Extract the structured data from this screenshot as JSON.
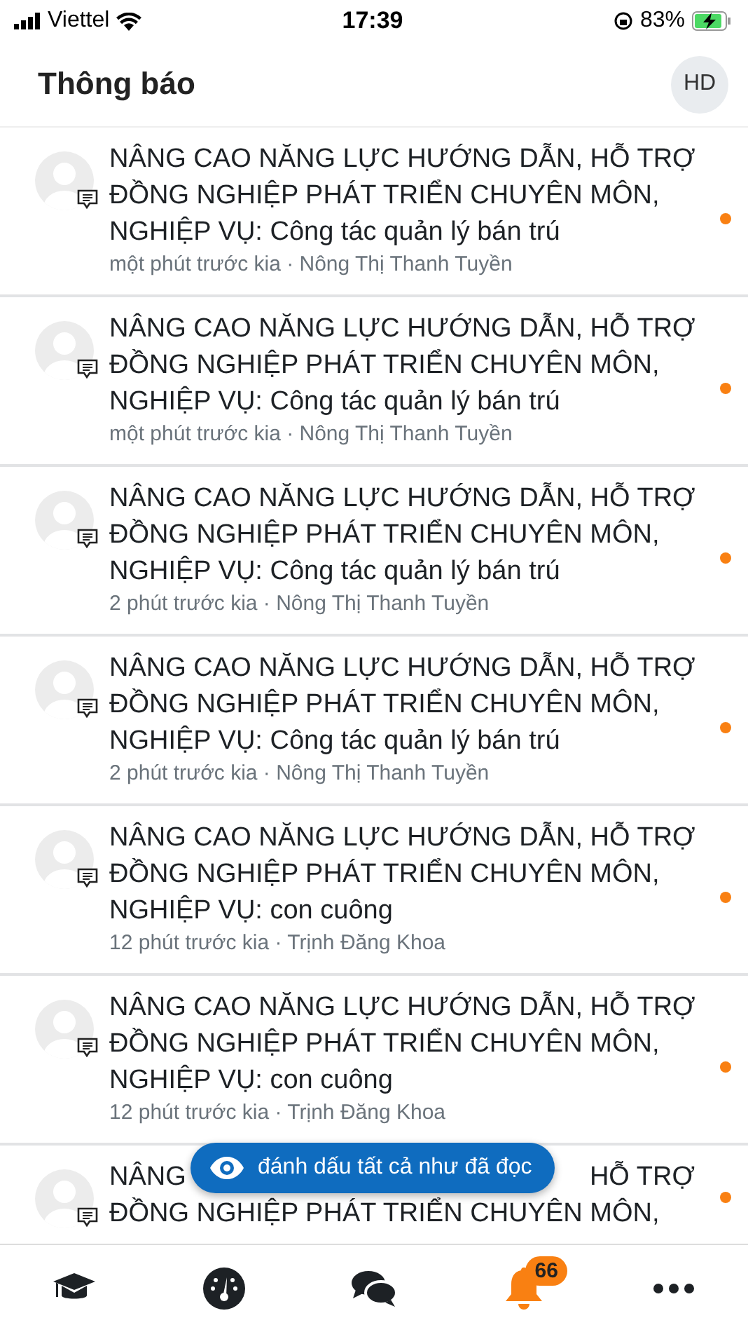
{
  "status_bar": {
    "carrier": "Viettel",
    "time": "17:39",
    "battery": "83%"
  },
  "header": {
    "title": "Thông báo",
    "avatar_initials": "HD"
  },
  "notifications": [
    {
      "title": "NÂNG CAO NĂNG LỰC HƯỚNG DẪN, HỖ TRỢ ĐỒNG NGHIỆP PHÁT TRIỂN CHUYÊN MÔN, NGHIỆP VỤ: Công tác quản lý bán trú",
      "meta": "một phút trước kia · Nông Thị Thanh Tuyền",
      "unread": true
    },
    {
      "title": "NÂNG CAO NĂNG LỰC HƯỚNG DẪN, HỖ TRỢ ĐỒNG NGHIỆP PHÁT TRIỂN CHUYÊN MÔN, NGHIỆP VỤ: Công tác quản lý bán trú",
      "meta": "một phút trước kia · Nông Thị Thanh Tuyền",
      "unread": true
    },
    {
      "title": "NÂNG CAO NĂNG LỰC HƯỚNG DẪN, HỖ TRỢ ĐỒNG NGHIỆP PHÁT TRIỂN CHUYÊN MÔN, NGHIỆP VỤ: Công tác quản lý bán trú",
      "meta": "2 phút trước kia · Nông Thị Thanh Tuyền",
      "unread": true
    },
    {
      "title": "NÂNG CAO NĂNG LỰC HƯỚNG DẪN, HỖ TRỢ ĐỒNG NGHIỆP PHÁT TRIỂN CHUYÊN MÔN, NGHIỆP VỤ: Công tác quản lý bán trú",
      "meta": "2 phút trước kia · Nông Thị Thanh Tuyền",
      "unread": true
    },
    {
      "title": "NÂNG CAO NĂNG LỰC HƯỚNG DẪN, HỖ TRỢ ĐỒNG NGHIỆP PHÁT TRIỂN CHUYÊN MÔN, NGHIỆP VỤ: con cuông",
      "meta": "12 phút trước kia · Trịnh Đăng Khoa",
      "unread": true
    },
    {
      "title": "NÂNG CAO NĂNG LỰC HƯỚNG DẪN, HỖ TRỢ ĐỒNG NGHIỆP PHÁT TRIỂN CHUYÊN MÔN, NGHIỆP VỤ: con cuông",
      "meta": "12 phút trước kia · Trịnh Đăng Khoa",
      "unread": true
    },
    {
      "kind": "partial",
      "title_start": "NÂNG",
      "title_end": "HỖ TRỢ",
      "title_line2": "ĐỒNG NGHIỆP PHÁT TRIỂN CHUYÊN MÔN,",
      "unread": true
    }
  ],
  "mark_all_button": {
    "label": "đánh dấu tất cả như đã đọc"
  },
  "bottom_nav": [
    {
      "kind": "courses",
      "selected": false
    },
    {
      "kind": "dashboard",
      "selected": false
    },
    {
      "kind": "messages",
      "selected": false
    },
    {
      "kind": "notifications",
      "selected": true,
      "badge": "66"
    },
    {
      "kind": "more",
      "selected": false
    }
  ]
}
